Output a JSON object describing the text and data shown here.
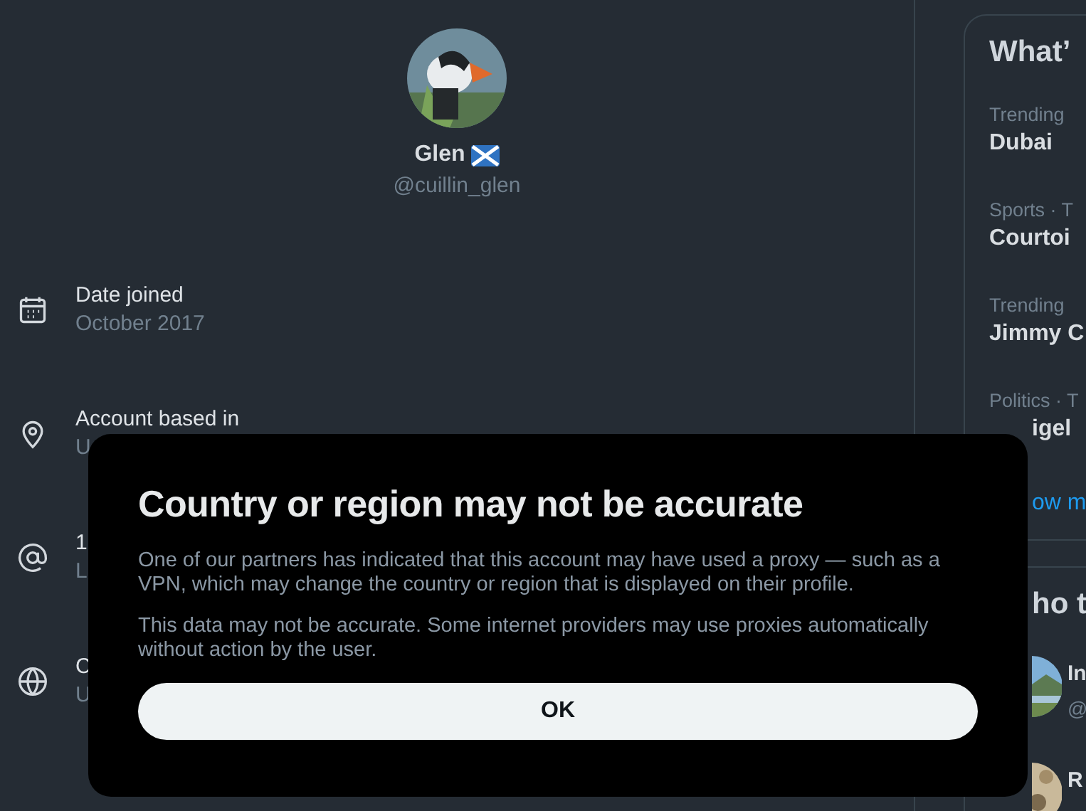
{
  "profile": {
    "name": "Glen",
    "handle": "@cuillin_glen"
  },
  "details": [
    {
      "kind": "calendar",
      "label": "Date joined",
      "value": "October 2017"
    },
    {
      "kind": "location",
      "label": "Account based in",
      "value": "U"
    },
    {
      "kind": "at",
      "label": "1",
      "value": "L"
    },
    {
      "kind": "globe",
      "label": "C",
      "value": "U"
    }
  ],
  "trends": {
    "title": "What’",
    "items": [
      {
        "context": "Trending",
        "topic": "Dubai",
        "overlapped": false
      },
      {
        "context": "Sports · T",
        "topic": "Courtoi",
        "overlapped": false
      },
      {
        "context": "Trending",
        "topic": "Jimmy C",
        "overlapped": false
      },
      {
        "context": "Politics · T",
        "topic": "igel",
        "overlapped": true
      }
    ],
    "show_more": "ow m"
  },
  "who_to_follow": {
    "title": "ho t",
    "accounts": [
      {
        "name": "In",
        "handle": "@"
      },
      {
        "name": "R"
      }
    ]
  },
  "dialog": {
    "title": "Country or region may not be accurate",
    "paragraphs": [
      "One of our partners has indicated that this account may have used a proxy — such as a VPN, which may change the country or region that is displayed on their profile.",
      "This data may not be accurate. Some internet providers may use proxies automatically without action by the user."
    ],
    "button": "OK"
  }
}
